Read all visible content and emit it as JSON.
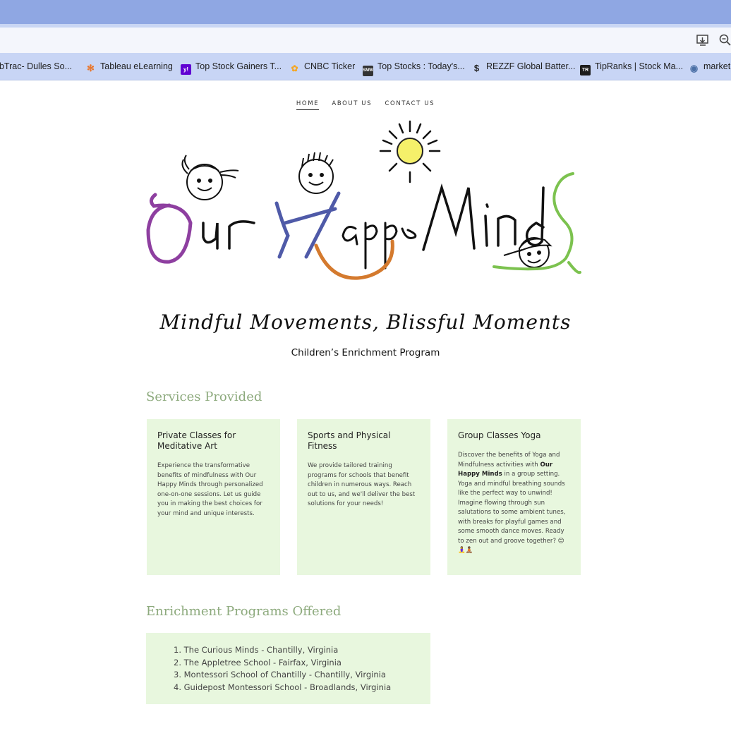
{
  "browser": {
    "bookmarks": [
      {
        "label": "ebTrac- Dulles So...",
        "icon": "none",
        "color": "#c8d5f5"
      },
      {
        "label": "Tableau eLearning",
        "icon": "tableau-icon",
        "color": "#e8772e"
      },
      {
        "label": "Top Stock Gainers T...",
        "icon": "yahoo-icon",
        "color": "#6001d2"
      },
      {
        "label": "CNBC Ticker",
        "icon": "cnbc-icon",
        "color": "#f5a623"
      },
      {
        "label": "Top Stocks : Today's...",
        "icon": "smw-icon",
        "color": "#333333"
      },
      {
        "label": "REZZF Global Batter...",
        "icon": "seeking-alpha-icon",
        "color": "#222222"
      },
      {
        "label": "TipRanks | Stock Ma...",
        "icon": "tipranks-icon",
        "color": "#1d1d1d"
      },
      {
        "label": "market",
        "icon": "globe-icon",
        "color": "#4a6fa5"
      }
    ]
  },
  "site": {
    "nav": [
      "HOME",
      "ABOUT US",
      "CONTACT US"
    ],
    "logo": {
      "word1": "Our",
      "word2": "Happy",
      "word3": "MindS"
    },
    "tagline": "Mindful Movements, Blissful Moments",
    "subtagline": "Children’s Enrichment Program"
  },
  "services": {
    "title": "Services Provided",
    "cards": [
      {
        "title": "Private Classes for Meditative Art",
        "body": " Experience the transformative benefits of mindfulness with Our Happy Minds through personalized one-on-one sessions. Let us guide you in making the best choices for your mind and unique interests."
      },
      {
        "title": "Sports and Physical Fitness",
        "body": " We provide tailored training programs for schools that benefit children in numerous ways. Reach out to us, and we'll deliver the best solutions for your needs!"
      },
      {
        "title": "Group Classes Yoga",
        "body_pre": "Discover the benefits of Yoga and Mindfulness activities with ",
        "body_bold": "Our Happy Minds",
        "body_post": " in a group setting. Yoga and mindful breathing sounds like the perfect way to unwind! Imagine flowing through sun salutations to some ambient tunes, with breaks for playful games and some smooth dance moves. Ready to zen out and groove together? 😊🧘‍♀️🧘🏾"
      }
    ]
  },
  "programs": {
    "title": "Enrichment Programs Offered",
    "items": [
      "1. The Curious Minds - Chantilly, Virginia",
      "2. The Appletree School - Fairfax, Virginia",
      "3. Montessori School of Chantilly - Chantilly, Virginia",
      "4. Guidepost Montessori School - Broadlands, Virginia"
    ]
  },
  "colors": {
    "accent_green": "#8daa7d",
    "card_bg": "#e8f7de",
    "browser_tab": "#8fa7e3",
    "logo_purple": "#8e3fa0",
    "logo_blue": "#4f5aa8",
    "logo_orange": "#d47a2e",
    "logo_green": "#7cc24f",
    "sun_yellow": "#f5f06a"
  }
}
